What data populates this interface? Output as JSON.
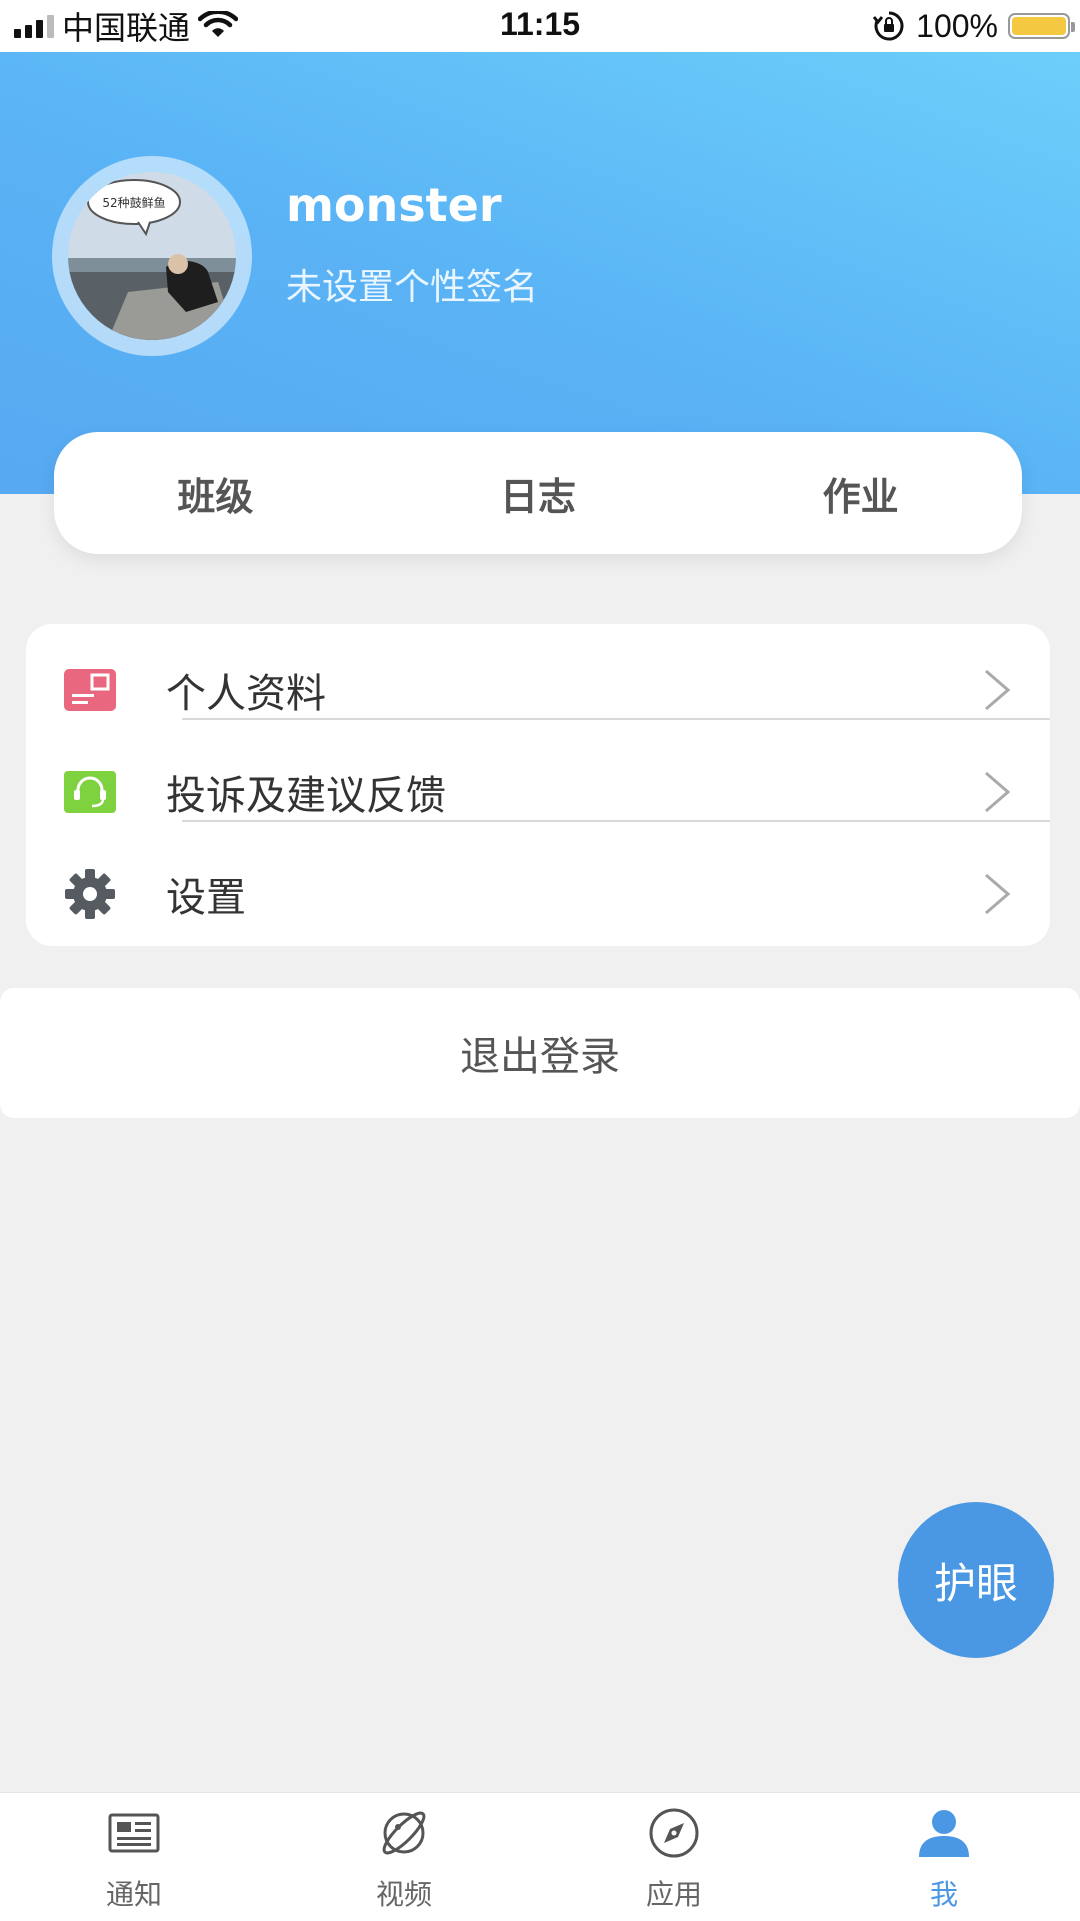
{
  "status_bar": {
    "carrier": "中国联通",
    "time": "11:15",
    "battery": "100%",
    "battery_level": 1.0
  },
  "profile": {
    "username": "monster",
    "signature": "未设置个性签名",
    "avatar_caption": "52种鼓鲜鱼"
  },
  "tabs": [
    {
      "label": "班级"
    },
    {
      "label": "日志"
    },
    {
      "label": "作业"
    }
  ],
  "menu": {
    "items": [
      {
        "label": "个人资料",
        "icon": "profile-card-icon",
        "color": "#e9677f"
      },
      {
        "label": "投诉及建议反馈",
        "icon": "headset-icon",
        "color": "#7ed13f"
      },
      {
        "label": "设置",
        "icon": "gear-icon",
        "color": "#555b61"
      }
    ]
  },
  "logout": {
    "label": "退出登录"
  },
  "eye_care": {
    "label": "护眼",
    "color": "#4a97e4"
  },
  "tabbar": {
    "active_color": "#4a97e4",
    "items": [
      {
        "label": "通知",
        "icon": "newspaper-icon"
      },
      {
        "label": "视频",
        "icon": "planet-icon"
      },
      {
        "label": "应用",
        "icon": "compass-icon"
      },
      {
        "label": "我",
        "icon": "person-icon",
        "active": true
      }
    ]
  }
}
